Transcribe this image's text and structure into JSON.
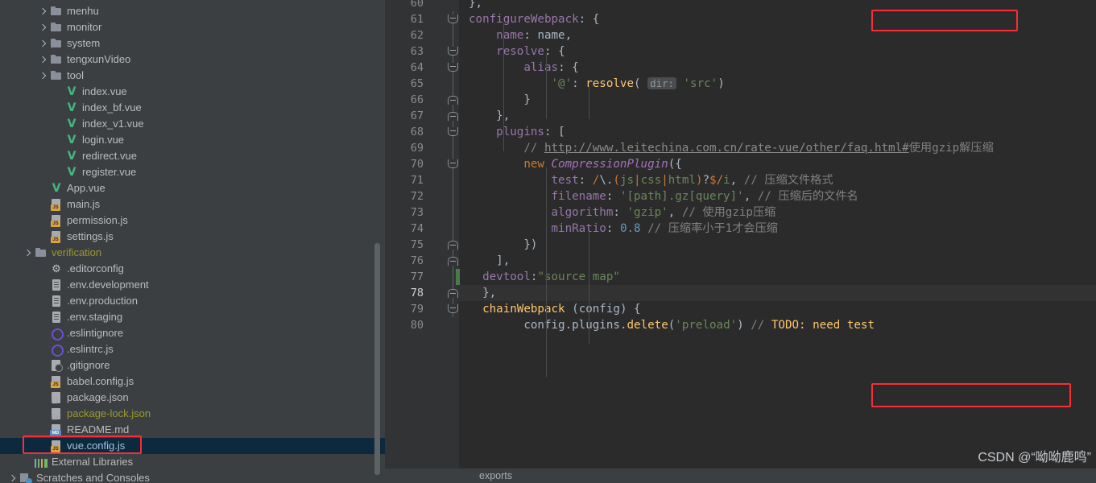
{
  "sidebar": {
    "scrollbar": "vertical-scrollbar",
    "items": [
      {
        "label": "menhu",
        "icon": "folder-icon",
        "indent": 3,
        "arrow": true,
        "color": "gray",
        "selected": false
      },
      {
        "label": "monitor",
        "icon": "folder-icon",
        "indent": 3,
        "arrow": true,
        "color": "gray",
        "selected": false
      },
      {
        "label": "system",
        "icon": "folder-icon",
        "indent": 3,
        "arrow": true,
        "color": "gray",
        "selected": false
      },
      {
        "label": "tengxunVideo",
        "icon": "folder-icon",
        "indent": 3,
        "arrow": true,
        "color": "gray",
        "selected": false
      },
      {
        "label": "tool",
        "icon": "folder-icon",
        "indent": 3,
        "arrow": true,
        "color": "gray",
        "selected": false
      },
      {
        "label": "index.vue",
        "icon": "vue-icon",
        "indent": 4,
        "arrow": false,
        "color": "gray",
        "selected": false
      },
      {
        "label": "index_bf.vue",
        "icon": "vue-icon",
        "indent": 4,
        "arrow": false,
        "color": "gray",
        "selected": false
      },
      {
        "label": "index_v1.vue",
        "icon": "vue-icon",
        "indent": 4,
        "arrow": false,
        "color": "gray",
        "selected": false
      },
      {
        "label": "login.vue",
        "icon": "vue-icon",
        "indent": 4,
        "arrow": false,
        "color": "gray",
        "selected": false
      },
      {
        "label": "redirect.vue",
        "icon": "vue-icon",
        "indent": 4,
        "arrow": false,
        "color": "gray",
        "selected": false
      },
      {
        "label": "register.vue",
        "icon": "vue-icon",
        "indent": 4,
        "arrow": false,
        "color": "gray",
        "selected": false
      },
      {
        "label": "App.vue",
        "icon": "vue-icon",
        "indent": 3,
        "arrow": false,
        "color": "gray",
        "selected": false
      },
      {
        "label": "main.js",
        "icon": "js-file-icon",
        "indent": 3,
        "arrow": false,
        "color": "gray",
        "selected": false
      },
      {
        "label": "permission.js",
        "icon": "js-file-icon",
        "indent": 3,
        "arrow": false,
        "color": "gray",
        "selected": false
      },
      {
        "label": "settings.js",
        "icon": "js-file-icon",
        "indent": 3,
        "arrow": false,
        "color": "gray",
        "selected": false
      },
      {
        "label": "verification",
        "icon": "folder-icon",
        "indent": 2,
        "arrow": true,
        "color": "olive",
        "selected": false
      },
      {
        "label": ".editorconfig",
        "icon": "gear-icon",
        "indent": 3,
        "arrow": false,
        "color": "gray",
        "selected": false
      },
      {
        "label": ".env.development",
        "icon": "text-file-icon",
        "indent": 3,
        "arrow": false,
        "color": "gray",
        "selected": false
      },
      {
        "label": ".env.production",
        "icon": "text-file-icon",
        "indent": 3,
        "arrow": false,
        "color": "gray",
        "selected": false
      },
      {
        "label": ".env.staging",
        "icon": "text-file-icon",
        "indent": 3,
        "arrow": false,
        "color": "gray",
        "selected": false
      },
      {
        "label": ".eslintignore",
        "icon": "eslint-icon",
        "indent": 3,
        "arrow": false,
        "color": "gray",
        "selected": false
      },
      {
        "label": ".eslintrc.js",
        "icon": "eslint-icon",
        "indent": 3,
        "arrow": false,
        "color": "gray",
        "selected": false
      },
      {
        "label": ".gitignore",
        "icon": "git-file-icon",
        "indent": 3,
        "arrow": false,
        "color": "gray",
        "selected": false
      },
      {
        "label": "babel.config.js",
        "icon": "js-file-icon",
        "indent": 3,
        "arrow": false,
        "color": "gray",
        "selected": false
      },
      {
        "label": "package.json",
        "icon": "json-file-icon",
        "indent": 3,
        "arrow": false,
        "color": "gray",
        "selected": false
      },
      {
        "label": "package-lock.json",
        "icon": "json-file-icon",
        "indent": 3,
        "arrow": false,
        "color": "olive",
        "selected": false
      },
      {
        "label": "README.md",
        "icon": "md-file-icon",
        "indent": 3,
        "arrow": false,
        "color": "gray",
        "selected": false
      },
      {
        "label": "vue.config.js",
        "icon": "js-file-icon",
        "indent": 3,
        "arrow": false,
        "color": "blue",
        "selected": true
      },
      {
        "label": "External Libraries",
        "icon": "libraries-icon",
        "indent": 2,
        "arrow": false,
        "color": "gray",
        "selected": false
      },
      {
        "label": "Scratches and Consoles",
        "icon": "scratches-icon",
        "indent": 1,
        "arrow": true,
        "color": "gray",
        "selected": false
      }
    ]
  },
  "editor": {
    "status_text": "exports",
    "watermark": "CSDN @“呦呦鹿鸣”",
    "highlight_color": "#fb2c36",
    "current_line": 78,
    "changed_line": 77,
    "lines": [
      {
        "num": 60,
        "fold": "none"
      },
      {
        "num": 61,
        "fold": "down"
      },
      {
        "num": 62,
        "fold": "none"
      },
      {
        "num": 63,
        "fold": "down"
      },
      {
        "num": 64,
        "fold": "down"
      },
      {
        "num": 65,
        "fold": "none"
      },
      {
        "num": 66,
        "fold": "up"
      },
      {
        "num": 67,
        "fold": "up"
      },
      {
        "num": 68,
        "fold": "down"
      },
      {
        "num": 69,
        "fold": "none"
      },
      {
        "num": 70,
        "fold": "down"
      },
      {
        "num": 71,
        "fold": "none"
      },
      {
        "num": 72,
        "fold": "none"
      },
      {
        "num": 73,
        "fold": "none"
      },
      {
        "num": 74,
        "fold": "none"
      },
      {
        "num": 75,
        "fold": "up"
      },
      {
        "num": 76,
        "fold": "up"
      },
      {
        "num": 77,
        "fold": "none"
      },
      {
        "num": 78,
        "fold": "up"
      },
      {
        "num": 79,
        "fold": "down"
      },
      {
        "num": 80,
        "fold": "none"
      }
    ],
    "code_text": [
      "},",
      "configureWebpack: {",
      "    name: name,",
      "    resolve: {",
      "        alias: {",
      "            '@': resolve( dir: 'src')",
      "        }",
      "    },",
      "    plugins: [",
      "        // http://www.leitechina.com.cn/rate-vue/other/faq.html#使用gzip解压缩",
      "        new CompressionPlugin({",
      "            test: /\\.(js|css|html)?$/i, // 压缩文件格式",
      "            filename: '[path].gz[query]', // 压缩后的文件名",
      "            algorithm: 'gzip', // 使用gzip压缩",
      "            minRatio: 0.8 // 压缩率小于1才会压缩",
      "        })",
      "    ],",
      "  devtool:\"source map\"",
      "},",
      "chainWebpack (config) {",
      "    config.plugins.delete('preload') // TODO: need test"
    ],
    "annotations": [
      {
        "name": "configure-webpack-highlight",
        "target": "configureWebpack:"
      },
      {
        "name": "devtool-highlight",
        "target": "devtool:\"source map\""
      },
      {
        "name": "vue-config-highlight",
        "target": "vue.config.js"
      }
    ]
  }
}
